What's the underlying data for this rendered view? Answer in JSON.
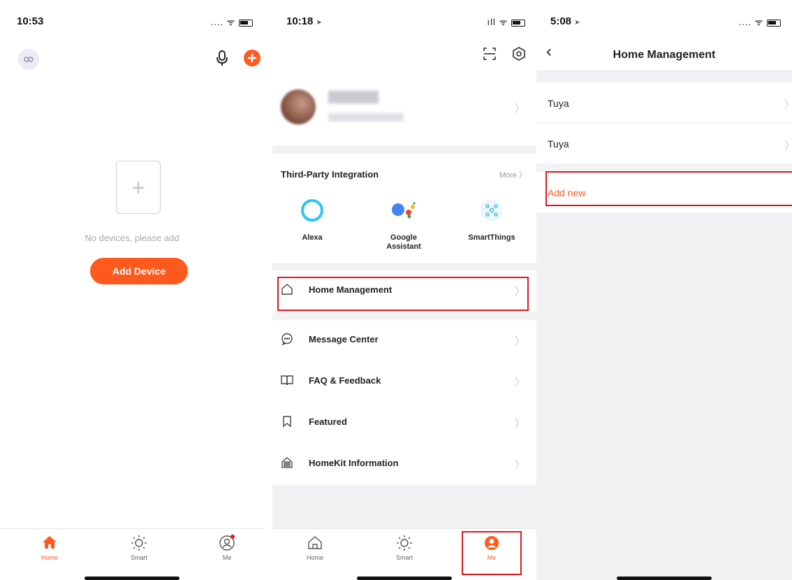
{
  "screen1": {
    "time": "10:53",
    "status_icons": "....  ᯤ",
    "empty_text": "No devices, please add",
    "add_device_label": "Add Device",
    "tabs": [
      {
        "label": "Home",
        "icon": "house-filled-icon",
        "active": true
      },
      {
        "label": "Smart",
        "icon": "sun-icon",
        "active": false
      },
      {
        "label": "Me",
        "icon": "person-icon",
        "active": false
      }
    ]
  },
  "screen2": {
    "time": "10:18",
    "status_icons": "ıll ᯤ",
    "integration_title": "Third-Party Integration",
    "more_label": "More",
    "integrations": [
      {
        "label": "Alexa",
        "icon": "alexa-icon"
      },
      {
        "label": "Google Assistant",
        "icon": "google-assistant-icon"
      },
      {
        "label": "SmartThings",
        "icon": "smartthings-icon"
      }
    ],
    "menu": [
      {
        "label": "Home Management",
        "icon": "house-outline-icon"
      },
      {
        "label": "Message Center",
        "icon": "chat-bubble-icon"
      },
      {
        "label": "FAQ & Feedback",
        "icon": "book-icon"
      },
      {
        "label": "Featured",
        "icon": "bookmark-icon"
      },
      {
        "label": "HomeKit Information",
        "icon": "homekit-icon"
      }
    ],
    "tabs": [
      {
        "label": "Home",
        "icon": "house-outline-icon",
        "active": false
      },
      {
        "label": "Smart",
        "icon": "sun-icon",
        "active": false
      },
      {
        "label": "Me",
        "icon": "person-filled-icon",
        "active": true
      }
    ]
  },
  "screen3": {
    "time": "5:08",
    "status_icons": "....  ᯤ",
    "title": "Home Management",
    "homes": [
      "Tuya",
      "Tuya"
    ],
    "add_new_label": "Add new"
  },
  "colors": {
    "accent": "#ff5a1e",
    "highlight": "#e0161c",
    "background": "#f2f2f4"
  }
}
